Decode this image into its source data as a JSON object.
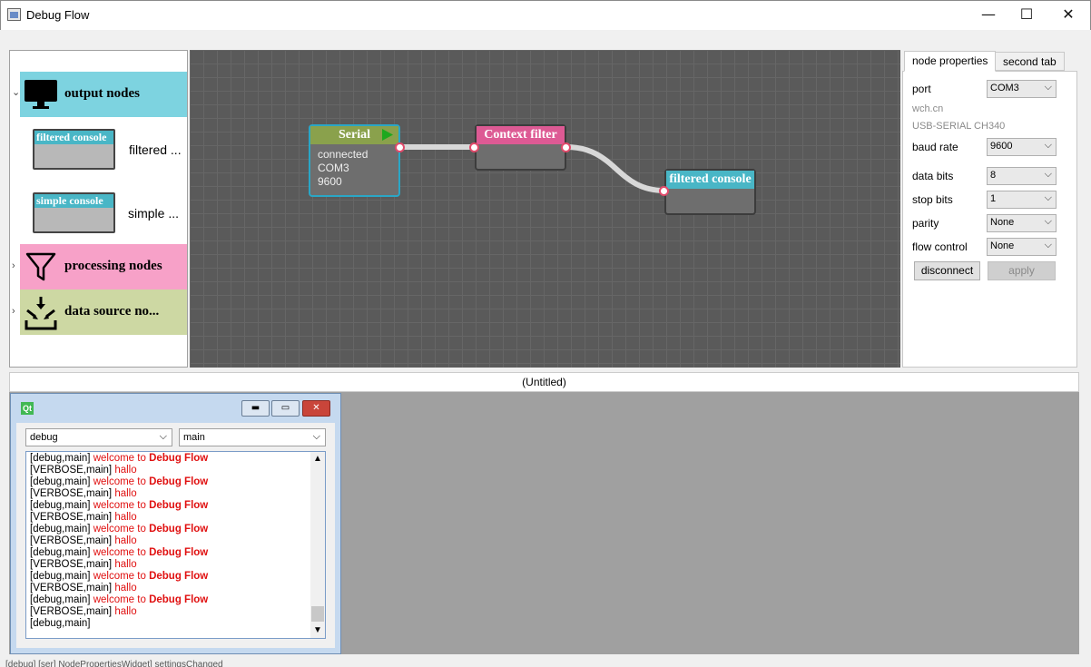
{
  "window": {
    "title": "Debug Flow",
    "minimize_glyph": "—",
    "maximize_glyph": "☐",
    "close_glyph": "✕"
  },
  "tree": {
    "categories": [
      {
        "label": "output nodes",
        "expanded": true,
        "color": "#7dd3e0",
        "icon": "monitor-icon"
      },
      {
        "label": "processing nodes",
        "expanded": false,
        "color": "#f7a1c8",
        "icon": "funnel-icon"
      },
      {
        "label": "data source no...",
        "expanded": false,
        "color": "#cdd8a3",
        "icon": "inbox-arrows-icon"
      }
    ],
    "output_items": [
      {
        "thumb_label": "filtered console",
        "name": "filtered ..."
      },
      {
        "thumb_label": "simple console",
        "name": "simple ..."
      }
    ],
    "expand_glyph": "⌄",
    "collapsed_glyph": "›"
  },
  "canvas": {
    "nodes": [
      {
        "title": "Serial",
        "color": "#8aa14c",
        "lines": [
          "connected",
          "COM3",
          "9600"
        ]
      },
      {
        "title": "Context filter",
        "color": "#dd5a94"
      },
      {
        "title": "filtered console",
        "color": "#49b6c6"
      }
    ]
  },
  "props": {
    "tabs": [
      "node properties",
      "second tab"
    ],
    "port_label": "port",
    "port_value": "COM3",
    "vendor": "wch.cn",
    "device": "USB-SERIAL CH340",
    "baud_label": "baud rate",
    "baud_value": "9600",
    "databits_label": "data bits",
    "databits_value": "8",
    "stopbits_label": "stop bits",
    "stopbits_value": "1",
    "parity_label": "parity",
    "parity_value": "None",
    "flow_label": "flow control",
    "flow_value": "None",
    "disconnect_label": "disconnect",
    "apply_label": "apply",
    "chevron": "⌵"
  },
  "mdi": {
    "title": "(Untitled)",
    "qt_logo": "Qt",
    "level_combo": "debug",
    "context_combo": "main",
    "log": [
      {
        "prefix": "[debug,main]",
        "msg": "welcome to",
        "bold": "Debug Flow"
      },
      {
        "prefix": "[VERBOSE,main]",
        "msg": "hallo",
        "bold": ""
      },
      {
        "prefix": "[debug,main]",
        "msg": "welcome to",
        "bold": "Debug Flow"
      },
      {
        "prefix": "[VERBOSE,main]",
        "msg": "hallo",
        "bold": ""
      },
      {
        "prefix": "[debug,main]",
        "msg": "welcome to",
        "bold": "Debug Flow"
      },
      {
        "prefix": "[VERBOSE,main]",
        "msg": "hallo",
        "bold": ""
      },
      {
        "prefix": "[debug,main]",
        "msg": "welcome to",
        "bold": "Debug Flow"
      },
      {
        "prefix": "[VERBOSE,main]",
        "msg": "hallo",
        "bold": ""
      },
      {
        "prefix": "[debug,main]",
        "msg": "welcome to",
        "bold": "Debug Flow"
      },
      {
        "prefix": "[VERBOSE,main]",
        "msg": "hallo",
        "bold": ""
      },
      {
        "prefix": "[debug,main]",
        "msg": "welcome to",
        "bold": "Debug Flow"
      },
      {
        "prefix": "[VERBOSE,main]",
        "msg": "hallo",
        "bold": ""
      },
      {
        "prefix": "[debug,main]",
        "msg": "welcome to",
        "bold": "Debug Flow"
      },
      {
        "prefix": "[VERBOSE,main]",
        "msg": "hallo",
        "bold": ""
      },
      {
        "prefix": "[debug,main]",
        "msg": "",
        "bold": ""
      }
    ]
  },
  "status": {
    "text": "[debug] [ser] NodePropertiesWidget] settingsChanged"
  }
}
